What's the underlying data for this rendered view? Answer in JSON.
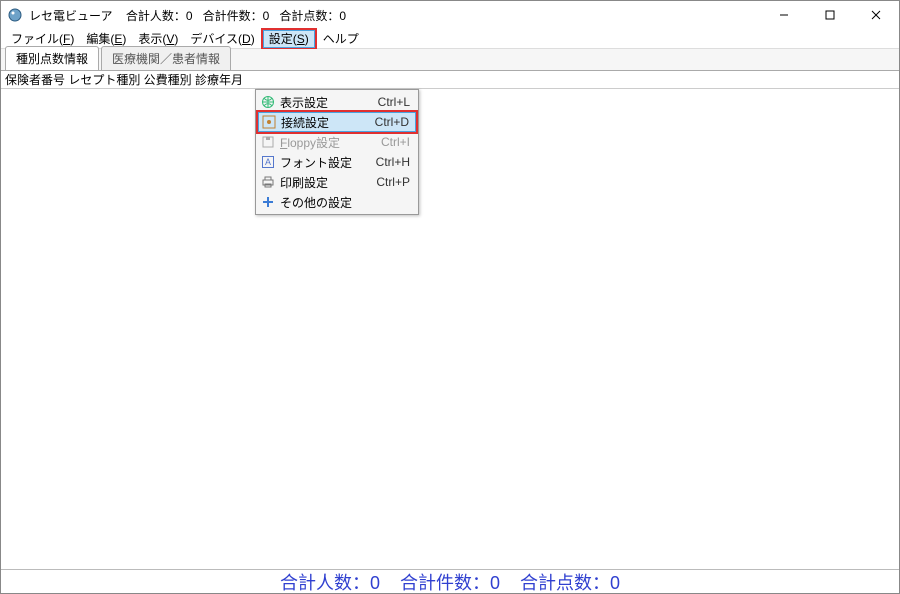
{
  "titlebar": {
    "app_name": "レセ電ビューア",
    "summary_people_label": "合計人数：",
    "summary_people_value": "0",
    "summary_count_label": "合計件数：",
    "summary_count_value": "0",
    "summary_points_label": "合計点数：",
    "summary_points_value": "0"
  },
  "menubar": {
    "items": [
      {
        "label": "ファイル(",
        "mnemonic": "F",
        "suffix": ")"
      },
      {
        "label": "編集(",
        "mnemonic": "E",
        "suffix": ")"
      },
      {
        "label": "表示(",
        "mnemonic": "V",
        "suffix": ")"
      },
      {
        "label": "デバイス(",
        "mnemonic": "D",
        "suffix": ")"
      },
      {
        "label": "設定(",
        "mnemonic": "S",
        "suffix": ")"
      },
      {
        "label": "ヘルプ",
        "mnemonic": "",
        "suffix": ""
      }
    ]
  },
  "tabs": {
    "active": "種別点数情報",
    "inactive": "医療機関／患者情報"
  },
  "column_header_line": "保険者番号 レセプト種別 公費種別 診療年月",
  "dropdown": {
    "items": [
      {
        "icon": "globe-icon",
        "label": "表示設定",
        "shortcut": "Ctrl+L",
        "state": "normal"
      },
      {
        "icon": "connect-icon",
        "label": "接続設定",
        "shortcut": "Ctrl+D",
        "state": "selected"
      },
      {
        "icon": "floppy-icon",
        "pre": "",
        "ul": "F",
        "post": "loppy設定",
        "shortcut": "Ctrl+I",
        "state": "disabled"
      },
      {
        "icon": "font-icon",
        "label": "フォント設定",
        "shortcut": "Ctrl+H",
        "state": "normal"
      },
      {
        "icon": "printer-icon",
        "label": "印刷設定",
        "shortcut": "Ctrl+P",
        "state": "normal"
      },
      {
        "icon": "plus-icon",
        "label": "その他の設定",
        "shortcut": "",
        "state": "normal"
      }
    ]
  },
  "statusbar": {
    "people_label": "合計人数：",
    "people_value": "0",
    "count_label": "合計件数：",
    "count_value": "0",
    "points_label": "合計点数：",
    "points_value": "0"
  }
}
